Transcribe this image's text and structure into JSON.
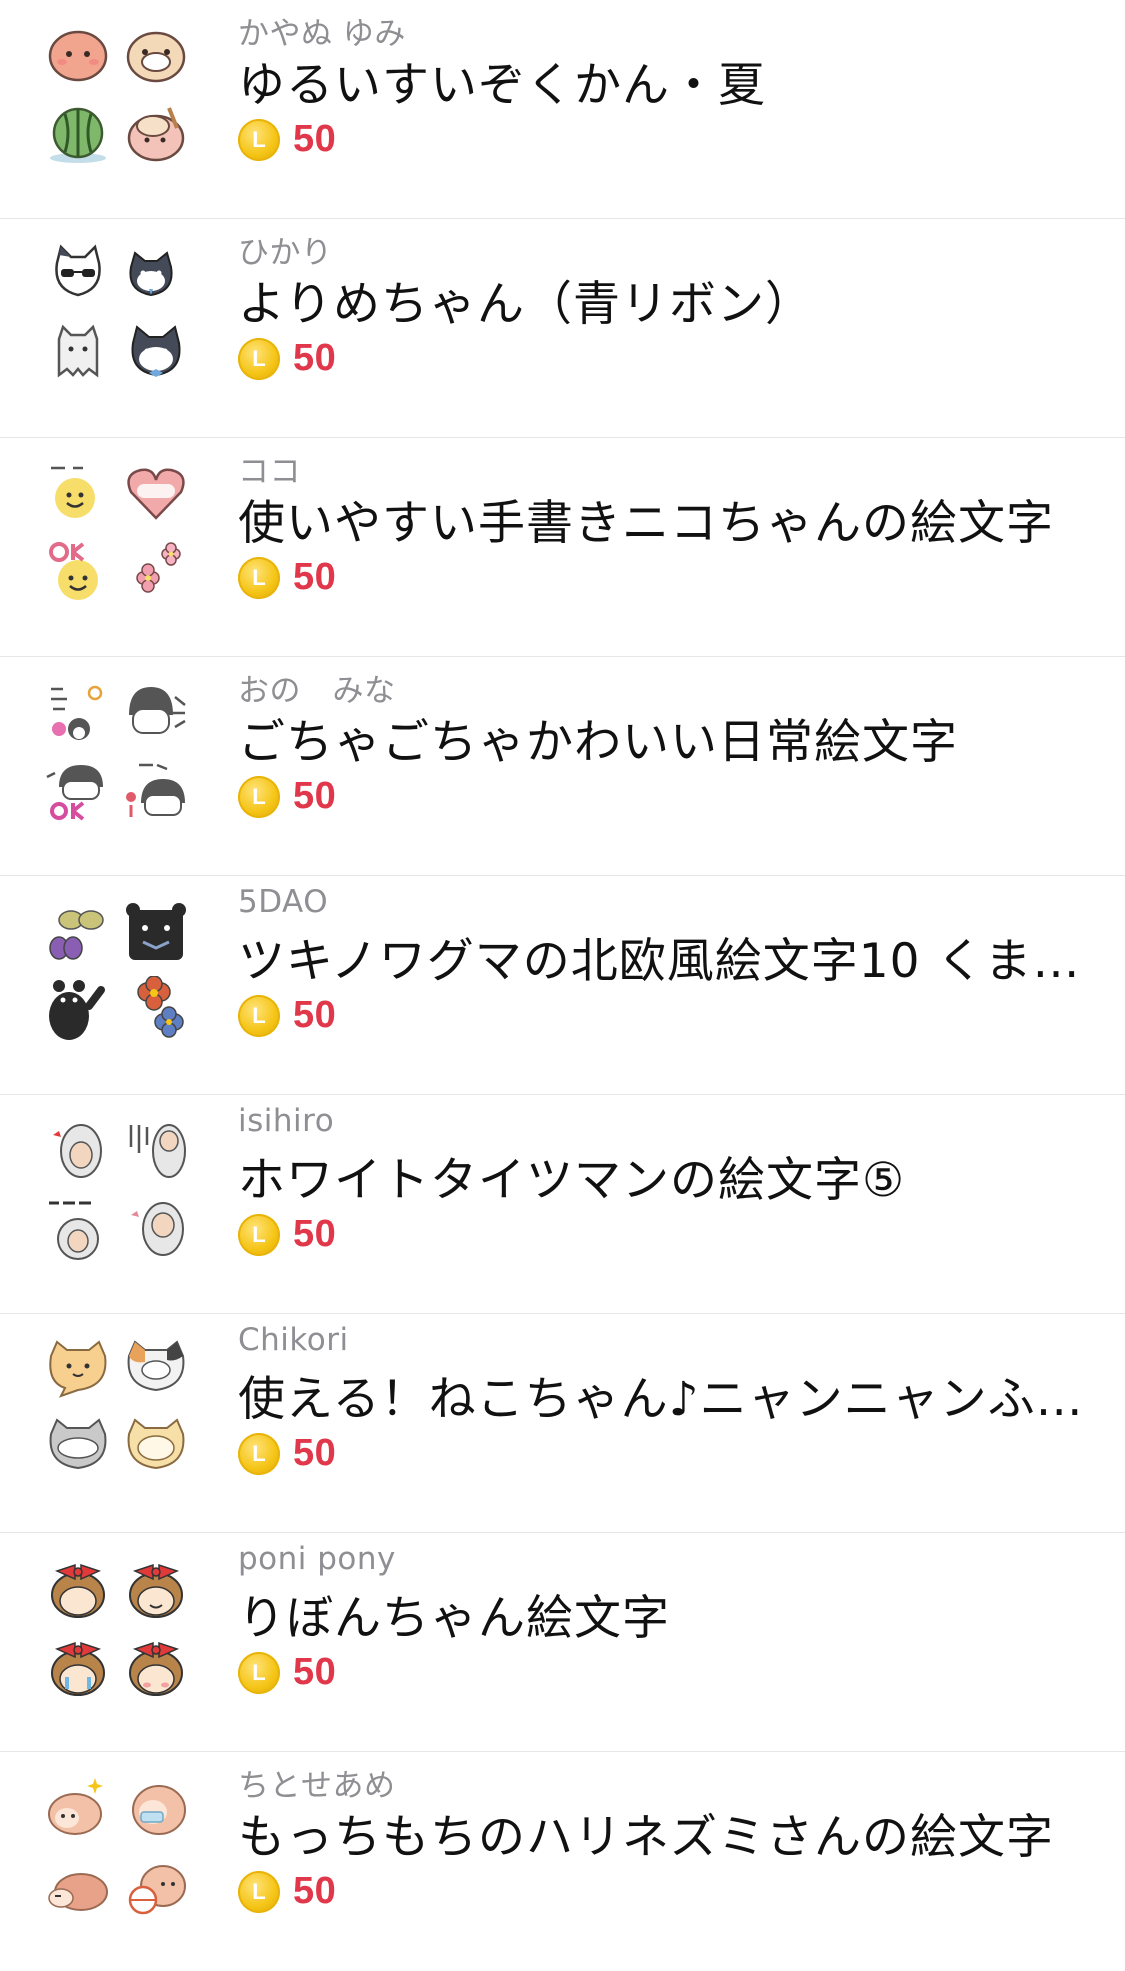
{
  "items": [
    {
      "author": "かやぬ ゆみ",
      "title": "ゆるいすいぞくかん・夏",
      "price": "50",
      "coin_label": "L",
      "thumbs": [
        "pink-octopus-icon",
        "otter-face-icon",
        "watermelon-icon",
        "pink-creature-icon"
      ],
      "colors": [
        "#f2a58e",
        "#f4d9b8",
        "#7fb86a",
        "#f3c2b8"
      ]
    },
    {
      "author": "ひかり",
      "title": "よりめちゃん（青リボン）",
      "price": "50",
      "coin_label": "L",
      "thumbs": [
        "cat-sunglasses-icon",
        "cat-pair-icon",
        "ghost-cat-icon",
        "cat-bow-icon"
      ],
      "colors": [
        "#444a58",
        "#444a58",
        "#f0f0f0",
        "#444a58"
      ]
    },
    {
      "author": "ココ",
      "title": "使いやすい手書きニコちゃんの絵文字",
      "price": "50",
      "coin_label": "L",
      "thumbs": [
        "smiley-face-icon",
        "hello-heart-icon",
        "ok-smiley-icon",
        "flowers-icon"
      ],
      "colors": [
        "#f7dd6a",
        "#f2a9a9",
        "#f7dd6a",
        "#f29fb0"
      ]
    },
    {
      "author": "おの　みな",
      "title": "ごちゃごちゃかわいい日常絵文字",
      "price": "50",
      "coin_label": "L",
      "thumbs": [
        "ohayo-girl-icon",
        "fight-girl-icon",
        "ok-girl-icon",
        "tehe-girl-icon"
      ],
      "colors": [
        "#e86fb0",
        "#555555",
        "#d64da0",
        "#e05a6a"
      ]
    },
    {
      "author": "5DAO",
      "title": "ツキノワグマの北欧風絵文字10 くま…",
      "price": "50",
      "coin_label": "L",
      "thumbs": [
        "butterfly-icon",
        "black-bear-face-icon",
        "black-bear-wave-icon",
        "flower-red-icon"
      ],
      "colors": [
        "#c9c47a",
        "#2a2a2a",
        "#2a2a2a",
        "#d9603c"
      ]
    },
    {
      "author": "isihiro",
      "title": "ホワイトタイツマンの絵文字⑤",
      "price": "50",
      "coin_label": "L",
      "thumbs": [
        "tights-man-heart-icon",
        "tights-man-text-icon",
        "iine-man-icon",
        "tights-man-point-icon"
      ],
      "colors": [
        "#e7e7e7",
        "#e7e7e7",
        "#e7e7e7",
        "#e7e7e7"
      ]
    },
    {
      "author": "Chikori",
      "title": "使える！ねこちゃん♪ニャンニャンふ…",
      "price": "50",
      "coin_label": "L",
      "thumbs": [
        "orange-cat-bubble-icon",
        "calico-cat-bubble-icon",
        "gray-cat-bubble-icon",
        "speech-bubble-icon"
      ],
      "colors": [
        "#f7cf8f",
        "#f2f2f2",
        "#c9c9c9",
        "#f7e0a8"
      ]
    },
    {
      "author": "poni pony",
      "title": "りぼんちゃん絵文字",
      "price": "50",
      "coin_label": "L",
      "thumbs": [
        "ribbon-girl-angry-icon",
        "ribbon-girl-smile-icon",
        "ribbon-girl-cry-icon",
        "ribbon-girl-wink-icon"
      ],
      "colors": [
        "#e23a3a",
        "#e23a3a",
        "#e23a3a",
        "#e23a3a"
      ]
    },
    {
      "author": "ちとせあめ",
      "title": "もっちもちのハリネズミさんの絵文字",
      "price": "50",
      "coin_label": "L",
      "thumbs": [
        "hedgehog-sparkle-icon",
        "hedgehog-mask-icon",
        "hedgehog-sleep-icon",
        "hedgehog-ball-icon"
      ],
      "colors": [
        "#f3c1a8",
        "#f3c1a8",
        "#f3c1a8",
        "#f3c1a8"
      ]
    }
  ]
}
